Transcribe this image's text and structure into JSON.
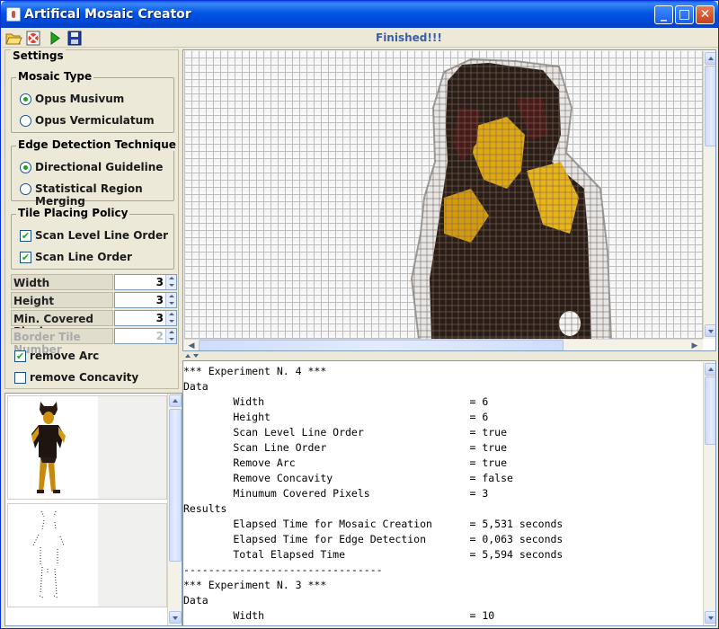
{
  "window": {
    "title": "Artifical Mosaic Creator"
  },
  "toolbar": {
    "open_icon": "folder-open-icon",
    "stop_icon": "stop-cancel-icon",
    "run_icon": "play-icon",
    "save_icon": "save-disk-icon",
    "status": "Finished!!!"
  },
  "settings": {
    "title": "Settings",
    "mosaic_type": {
      "title": "Mosaic Type",
      "options": [
        "Opus Musivum",
        "Opus Vermiculatum"
      ],
      "selected": "Opus Musivum"
    },
    "edge_detection": {
      "title": "Edge Detection Technique",
      "options": [
        "Directional Guideline",
        "Statistical Region Merging"
      ],
      "selected": "Directional Guideline"
    },
    "tile_policy": {
      "title": "Tile Placing Policy",
      "options": [
        {
          "label": "Scan Level Line Order",
          "checked": true
        },
        {
          "label": "Scan Line Order",
          "checked": true
        }
      ]
    },
    "fields": [
      {
        "label": "Width",
        "value": "3",
        "enabled": true
      },
      {
        "label": "Height",
        "value": "3",
        "enabled": true
      },
      {
        "label": "Min. Covered Pixels",
        "value": "3",
        "enabled": true
      },
      {
        "label": "Border Tile Number",
        "value": "2",
        "enabled": false
      }
    ],
    "remove_arc": {
      "label": "remove Arc",
      "checked": true
    },
    "remove_concavity": {
      "label": "remove Concavity",
      "checked": false
    }
  },
  "console": {
    "lines": [
      "*** Experiment N. 4 ***",
      "Data",
      "        Width                                 = 6",
      "        Height                                = 6",
      "        Scan Level Line Order                 = true",
      "        Scan Line Order                       = true",
      "        Remove Arc                            = true",
      "        Remove Concavity                      = false",
      "        Minumum Covered Pixels                = 3",
      "Results",
      "        Elapsed Time for Mosaic Creation      = 5,531 seconds",
      "        Elapsed Time for Edge Detection       = 0,063 seconds",
      "        Total Elapsed Time                    = 5,594 seconds",
      "--------------------------------",
      "*** Experiment N. 3 ***",
      "Data",
      "        Width                                 = 10"
    ]
  },
  "colors": {
    "title_blue": "#0055e5",
    "status_blue": "#3a5ea8",
    "tile_gold": "#e0a810",
    "tile_dark": "#2a1a14"
  }
}
